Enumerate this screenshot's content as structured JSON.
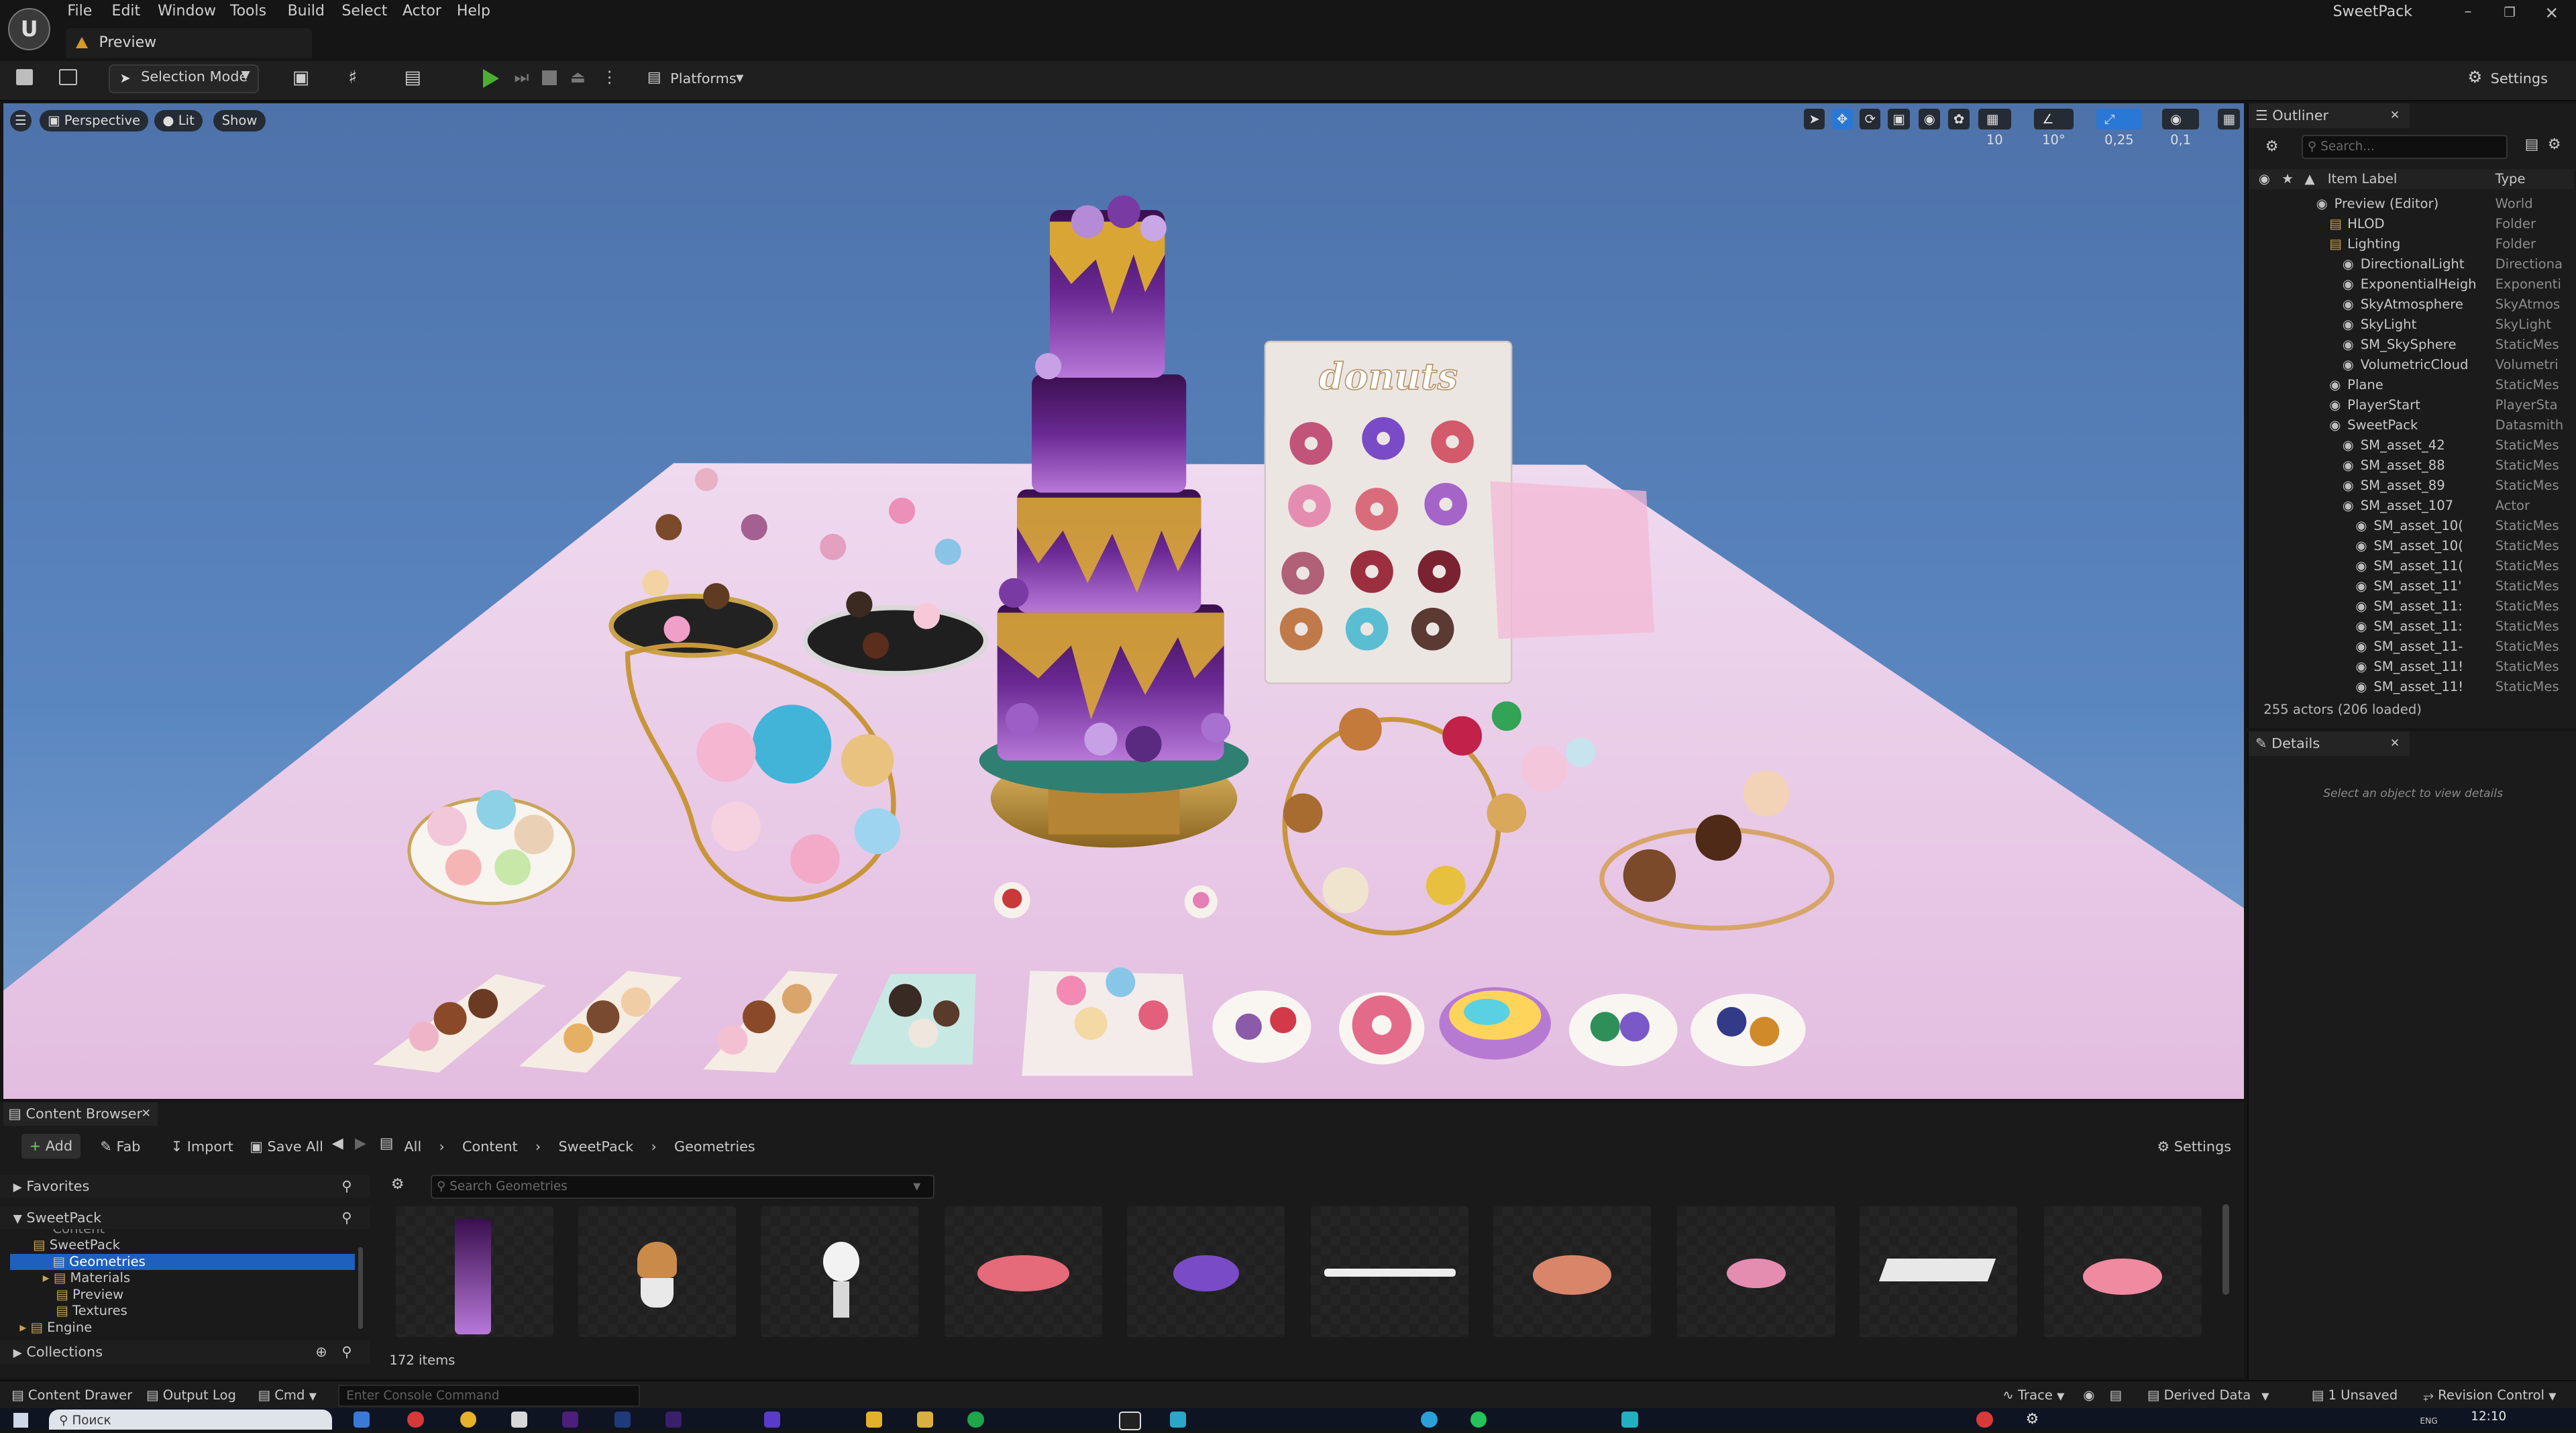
{
  "app": {
    "window_title": "SweetPack",
    "tab": "Preview"
  },
  "menu": [
    "File",
    "Edit",
    "Window",
    "Tools",
    "Build",
    "Select",
    "Actor",
    "Help"
  ],
  "toolbar": {
    "mode": "Selection Mode",
    "platforms": "Platforms",
    "settings": "Settings"
  },
  "viewport": {
    "perspective": "Perspective",
    "lit": "Lit",
    "show": "Show",
    "grid": "10",
    "angle": "10°",
    "scale": "0,25",
    "speed": "0,1",
    "sign": "donuts"
  },
  "outliner": {
    "title": "Outliner",
    "search_placeholder": "Search...",
    "col_label": "Item Label",
    "col_type": "Type",
    "rows": [
      {
        "label": "Preview (Editor)",
        "type": "World",
        "indent": 0
      },
      {
        "label": "HLOD",
        "type": "Folder",
        "indent": 1
      },
      {
        "label": "Lighting",
        "type": "Folder",
        "indent": 1
      },
      {
        "label": "DirectionalLight",
        "type": "Directiona",
        "indent": 2
      },
      {
        "label": "ExponentialHeigh",
        "type": "Exponenti",
        "indent": 2
      },
      {
        "label": "SkyAtmosphere",
        "type": "SkyAtmos",
        "indent": 2
      },
      {
        "label": "SkyLight",
        "type": "SkyLight",
        "indent": 2
      },
      {
        "label": "SM_SkySphere",
        "type": "StaticMes",
        "indent": 2
      },
      {
        "label": "VolumetricCloud",
        "type": "Volumetri",
        "indent": 2
      },
      {
        "label": "Plane",
        "type": "StaticMes",
        "indent": 1
      },
      {
        "label": "PlayerStart",
        "type": "PlayerSta",
        "indent": 1
      },
      {
        "label": "SweetPack",
        "type": "Datasmith",
        "indent": 1
      },
      {
        "label": "SM_asset_42",
        "type": "StaticMes",
        "indent": 2
      },
      {
        "label": "SM_asset_88",
        "type": "StaticMes",
        "indent": 2
      },
      {
        "label": "SM_asset_89",
        "type": "StaticMes",
        "indent": 2
      },
      {
        "label": "SM_asset_107",
        "type": "Actor",
        "indent": 2
      },
      {
        "label": "SM_asset_10(",
        "type": "StaticMes",
        "indent": 3
      },
      {
        "label": "SM_asset_10(",
        "type": "StaticMes",
        "indent": 3
      },
      {
        "label": "SM_asset_11(",
        "type": "StaticMes",
        "indent": 3
      },
      {
        "label": "SM_asset_11'",
        "type": "StaticMes",
        "indent": 3
      },
      {
        "label": "SM_asset_11:",
        "type": "StaticMes",
        "indent": 3
      },
      {
        "label": "SM_asset_11:",
        "type": "StaticMes",
        "indent": 3
      },
      {
        "label": "SM_asset_11-",
        "type": "StaticMes",
        "indent": 3
      },
      {
        "label": "SM_asset_11!",
        "type": "StaticMes",
        "indent": 3
      },
      {
        "label": "SM_asset_11!",
        "type": "StaticMes",
        "indent": 3
      }
    ],
    "count": "255 actors (206 loaded)"
  },
  "details": {
    "title": "Details",
    "empty": "Select an object to view details"
  },
  "content_browser": {
    "title": "Content Browser",
    "add": "Add",
    "fab": "Fab",
    "import": "Import",
    "save_all": "Save All",
    "breadcrumb": [
      "All",
      "Content",
      "SweetPack",
      "Geometries"
    ],
    "settings": "Settings",
    "favorites": "Favorites",
    "root": "SweetPack",
    "tree": [
      "Content",
      "SweetPack",
      "Geometries",
      "Materials",
      "Preview",
      "Textures",
      "Engine"
    ],
    "collections": "Collections",
    "search_placeholder": "Search Geometries",
    "item_count": "172 items"
  },
  "status": {
    "content_drawer": "Content Drawer",
    "output_log": "Output Log",
    "cmd": "Cmd",
    "console_placeholder": "Enter Console Command",
    "trace": "Trace",
    "derived_data": "Derived Data",
    "unsaved": "1 Unsaved",
    "revision": "Revision Control"
  },
  "taskbar": {
    "search": "Поиск",
    "time": "12:10",
    "lang": "ENG"
  }
}
